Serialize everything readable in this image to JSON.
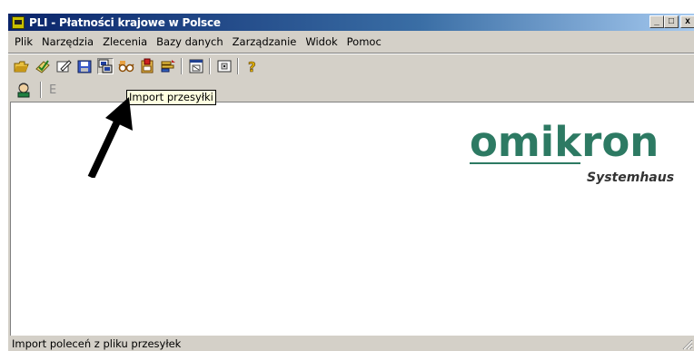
{
  "window": {
    "title": "PLI - Płatności krajowe w Polsce",
    "minimize_label": "_",
    "maximize_label": "□",
    "close_label": "x"
  },
  "menu": {
    "items": [
      "Plik",
      "Narzędzia",
      "Zlecenia",
      "Bazy danych",
      "Zarządzanie",
      "Widok",
      "Pomoc"
    ]
  },
  "toolbar": {
    "icons": [
      "open-folder-icon",
      "checked-document-icon",
      "edit-document-icon",
      "save-icon",
      "import-icon",
      "glasses-icon",
      "export-icon",
      "sort-icon",
      "window-icon",
      "settings-icon",
      "help-icon"
    ],
    "pressed": "import-icon"
  },
  "toolbar2": {
    "icons": [
      "user-icon"
    ],
    "letter": "E"
  },
  "tooltip": {
    "text": "Import przesyłki"
  },
  "logo": {
    "word": "omikron",
    "subtitle": "Systemhaus",
    "color": "#2d7a63"
  },
  "statusbar": {
    "text": "Import poleceń z pliku przesyłek"
  },
  "colors": {
    "titlebar_start": "#0a246a",
    "titlebar_end": "#a6caf0",
    "window_face": "#d4d0c8",
    "tooltip_bg": "#ffffe1"
  }
}
